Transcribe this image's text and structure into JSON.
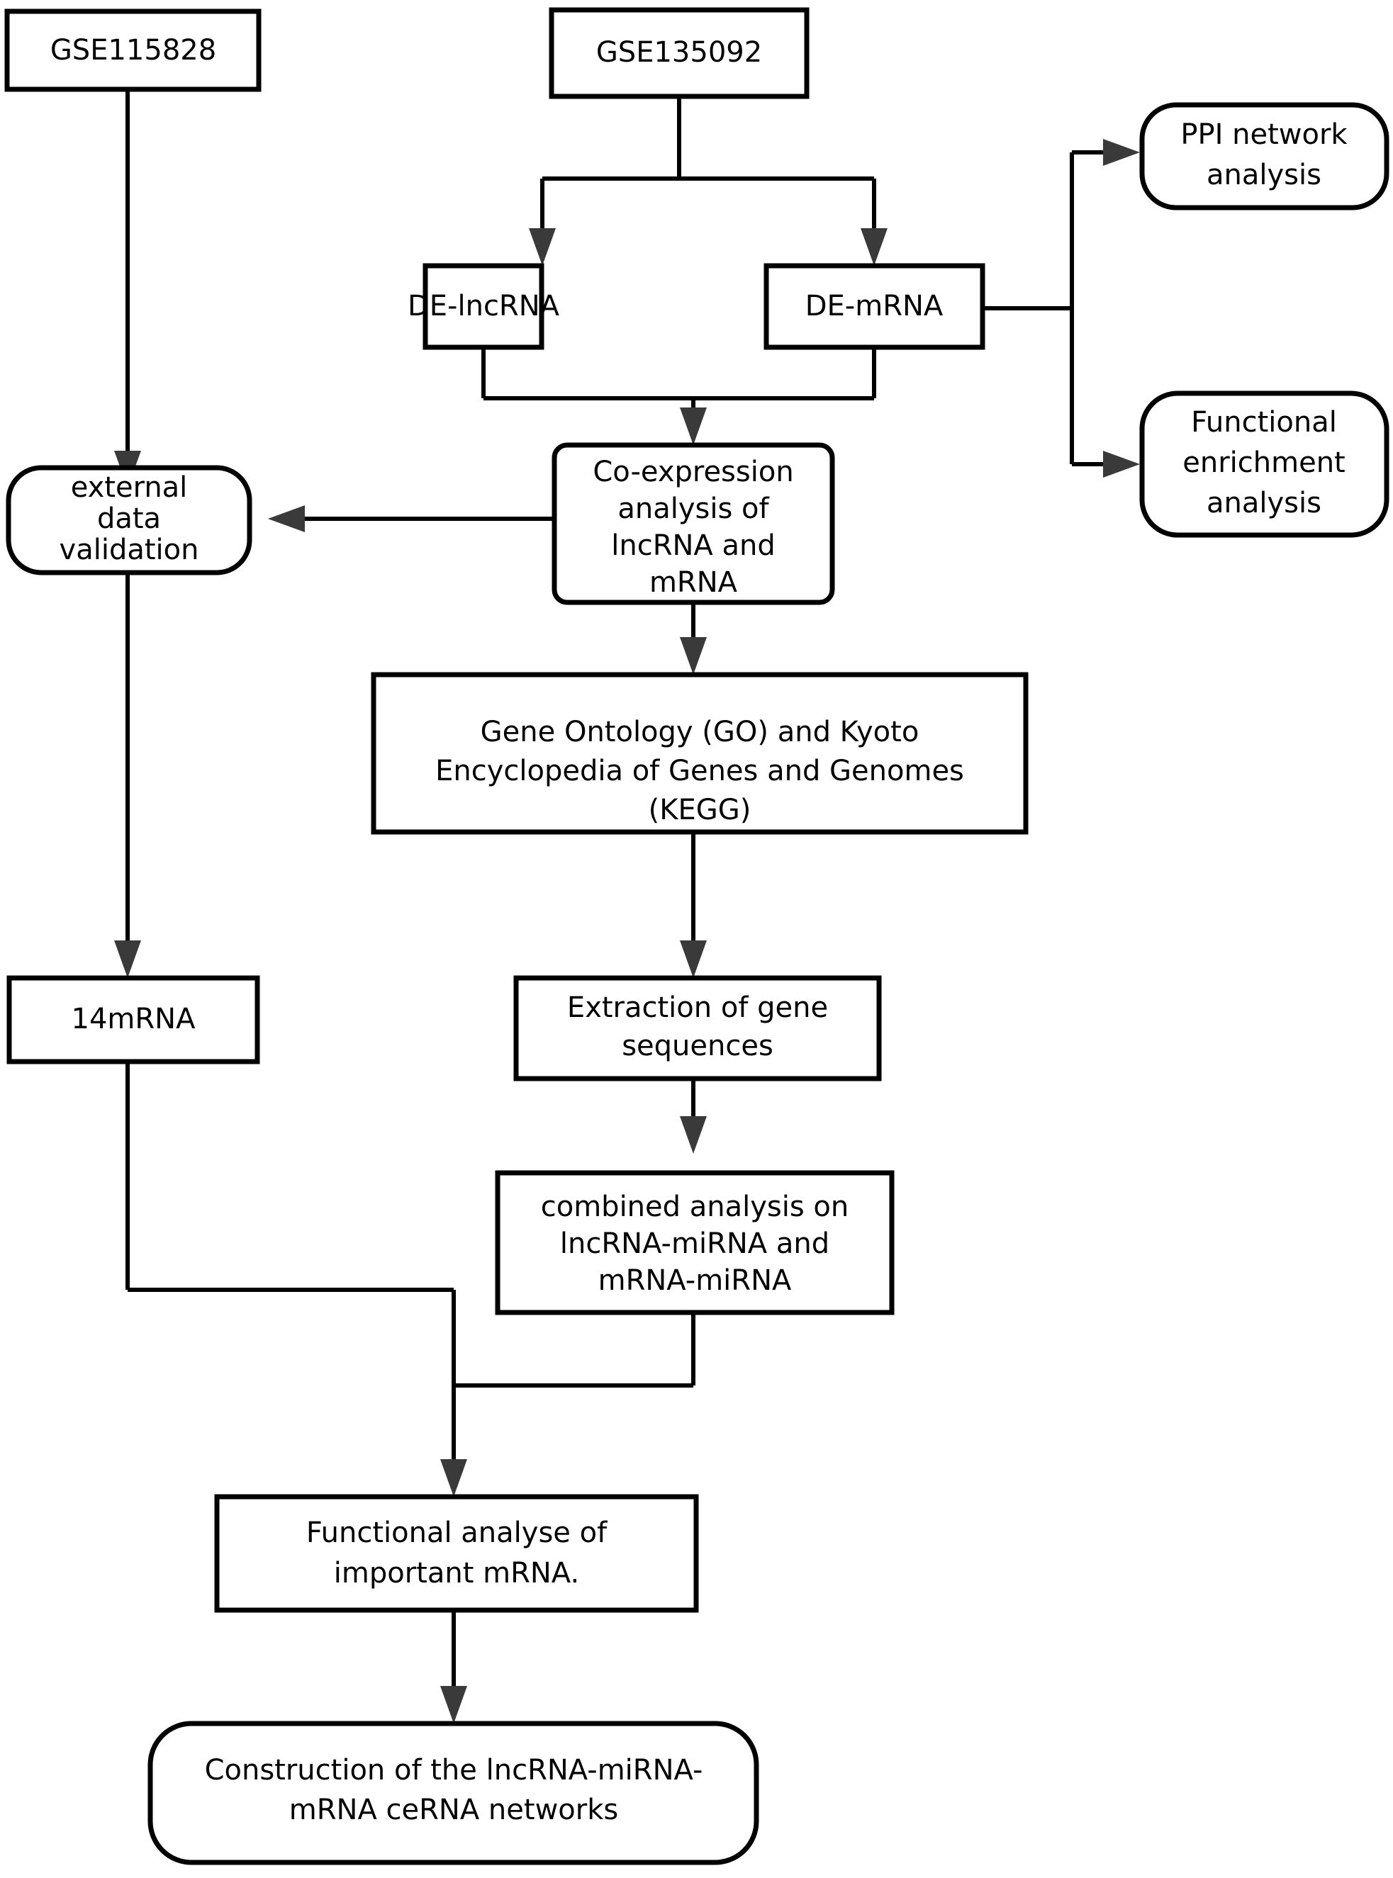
{
  "diagram": {
    "type": "flowchart",
    "title": "",
    "background_color": "#ffffff",
    "line_color": "#000000",
    "node_fill": "#ffffff",
    "arrow_fill": "#3a3a3a",
    "nodes": [
      {
        "id": "gse115828",
        "shape": "rectangle",
        "lines": [
          "GSE115828"
        ]
      },
      {
        "id": "gse135092",
        "shape": "rectangle",
        "lines": [
          "GSE135092"
        ]
      },
      {
        "id": "de_lncrna",
        "shape": "rectangle",
        "lines": [
          "DE-lncRNA"
        ]
      },
      {
        "id": "de_mrna",
        "shape": "rectangle",
        "lines": [
          "DE-mRNA"
        ]
      },
      {
        "id": "ppi",
        "shape": "rounded",
        "lines": [
          "PPI network",
          "analysis"
        ]
      },
      {
        "id": "func_enrich",
        "shape": "rounded",
        "lines": [
          "Functional",
          "enrichment",
          "analysis"
        ]
      },
      {
        "id": "ext_validation",
        "shape": "rounded",
        "lines": [
          "external",
          "data",
          "validation"
        ]
      },
      {
        "id": "coexpression",
        "shape": "rounded-rect",
        "lines": [
          "Co-expression",
          "analysis of",
          "lncRNA and",
          "mRNA"
        ]
      },
      {
        "id": "go_kegg",
        "shape": "rectangle",
        "lines": [
          "Gene Ontology (GO) and Kyoto",
          "Encyclopedia of Genes and Genomes",
          "(KEGG)"
        ]
      },
      {
        "id": "mrna14",
        "shape": "rectangle",
        "lines": [
          "14mRNA"
        ]
      },
      {
        "id": "extraction",
        "shape": "rectangle",
        "lines": [
          "Extraction of gene",
          "sequences"
        ]
      },
      {
        "id": "combined",
        "shape": "rectangle",
        "lines": [
          "combined analysis on",
          "lncRNA-miRNA and",
          "mRNA-miRNA"
        ]
      },
      {
        "id": "func_analyse",
        "shape": "rectangle",
        "lines": [
          "Functional analyse of",
          "important mRNA."
        ]
      },
      {
        "id": "construction",
        "shape": "rounded",
        "lines": [
          "Construction of the lncRNA-miRNA-",
          "mRNA ceRNA networks"
        ]
      }
    ],
    "edges": [
      {
        "from": "gse115828",
        "to": "ext_validation",
        "arrow": true
      },
      {
        "from": "gse135092",
        "to": "de_lncrna",
        "arrow": true
      },
      {
        "from": "gse135092",
        "to": "de_mrna",
        "arrow": true
      },
      {
        "from": "de_mrna",
        "to": "ppi",
        "arrow": true
      },
      {
        "from": "de_mrna",
        "to": "func_enrich",
        "arrow": true
      },
      {
        "from": "de_lncrna",
        "to": "coexpression",
        "arrow": true
      },
      {
        "from": "de_mrna",
        "to": "coexpression",
        "arrow": true
      },
      {
        "from": "coexpression",
        "to": "ext_validation",
        "arrow": true
      },
      {
        "from": "coexpression",
        "to": "go_kegg",
        "arrow": true
      },
      {
        "from": "ext_validation",
        "to": "mrna14",
        "arrow": true
      },
      {
        "from": "go_kegg",
        "to": "extraction",
        "arrow": true
      },
      {
        "from": "extraction",
        "to": "combined",
        "arrow": true
      },
      {
        "from": "mrna14",
        "to": "func_analyse",
        "arrow": true
      },
      {
        "from": "combined",
        "to": "func_analyse",
        "arrow": true
      },
      {
        "from": "func_analyse",
        "to": "construction",
        "arrow": true
      }
    ]
  },
  "labels": {
    "gse115828": "GSE115828",
    "gse135092": "GSE135092",
    "de_lncrna": "DE-lncRNA",
    "de_mrna": "DE-mRNA",
    "ppi_l1": "PPI network",
    "ppi_l2": "analysis",
    "func_enrich_l1": "Functional",
    "func_enrich_l2": "enrichment",
    "func_enrich_l3": "analysis",
    "ext_validation_l1": "external",
    "ext_validation_l2": "data",
    "ext_validation_l3": "validation",
    "coexpression_l1": "Co-expression",
    "coexpression_l2": "analysis of",
    "coexpression_l3": "lncRNA and",
    "coexpression_l4": "mRNA",
    "go_kegg_l1": "Gene Ontology (GO) and Kyoto",
    "go_kegg_l2": "Encyclopedia of Genes and Genomes",
    "go_kegg_l3": "(KEGG)",
    "mrna14": "14mRNA",
    "extraction_l1": "Extraction of gene",
    "extraction_l2": "sequences",
    "combined_l1": "combined analysis on",
    "combined_l2": "lncRNA-miRNA and",
    "combined_l3": "mRNA-miRNA",
    "func_analyse_l1": "Functional analyse of",
    "func_analyse_l2": "important mRNA.",
    "construction_l1": "Construction of the lncRNA-miRNA-",
    "construction_l2": "mRNA ceRNA networks"
  }
}
